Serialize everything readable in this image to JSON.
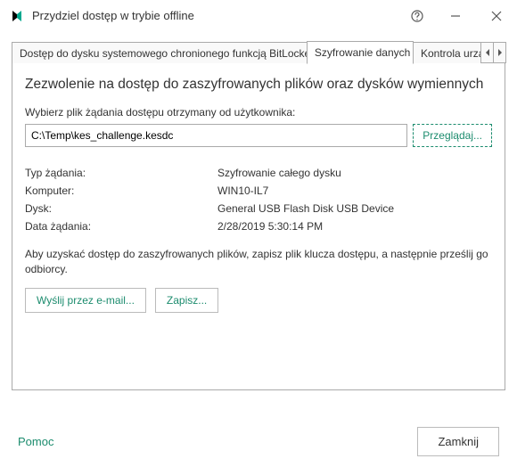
{
  "window": {
    "title": "Przydziel dostęp w trybie offline"
  },
  "tabs": {
    "bitlocker": "Dostęp do dysku systemowego chronionego funkcją BitLocker",
    "encryption": "Szyfrowanie danych",
    "device_control": "Kontrola urzą"
  },
  "heading": "Zezwolenie na dostęp do zaszyfrowanych plików oraz dysków wymiennych",
  "subheading": "Wybierz plik żądania dostępu otrzymany od użytkownika:",
  "file_path": "C:\\Temp\\kes_challenge.kesdc",
  "browse_label": "Przeglądaj...",
  "info": {
    "request_type_label": "Typ żądania:",
    "request_type_value": "Szyfrowanie całego dysku",
    "computer_label": "Komputer:",
    "computer_value": "WIN10-IL7",
    "disk_label": "Dysk:",
    "disk_value": "General USB Flash Disk USB Device",
    "date_label": "Data żądania:",
    "date_value": "2/28/2019 5:30:14 PM"
  },
  "instruction": "Aby uzyskać dostęp do zaszyfrowanych plików, zapisz plik klucza dostępu, a następnie prześlij go odbiorcy.",
  "actions": {
    "email": "Wyślij przez e-mail...",
    "save": "Zapisz..."
  },
  "footer": {
    "help": "Pomoc",
    "close": "Zamknij"
  }
}
